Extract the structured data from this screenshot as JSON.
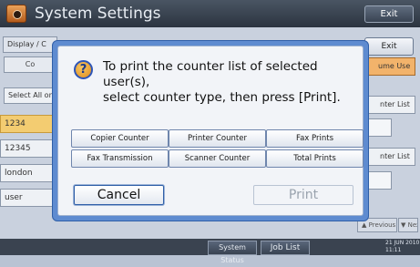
{
  "titlebar": {
    "title": "System Settings",
    "exit_label": "Exit"
  },
  "background": {
    "tab_display": "Display / C",
    "exit_label": "Exit",
    "tab_second": "Co",
    "tab_volume": "ume Use",
    "select_all": "Select All on",
    "printer_list_1": "nter List",
    "printer_list_2": "nter List",
    "rows": [
      "1234",
      "12345",
      "london",
      "user"
    ],
    "previous_label": "Previous",
    "next_label": "Next"
  },
  "dialog": {
    "message_line1": "To print the counter list of selected user(s),",
    "message_line2": "select counter type, then press [Print].",
    "counter_buttons": [
      "Copier Counter",
      "Printer Counter",
      "Fax Prints",
      "Fax Transmission",
      "Scanner Counter",
      "Total Prints"
    ],
    "cancel_label": "Cancel",
    "print_label": "Print"
  },
  "bottombar": {
    "system_status_label": "System Status",
    "job_list_label": "Job List",
    "date": "21 JUN 2010",
    "time": "11:11"
  },
  "colors": {
    "dialog_border": "#5e8bd0",
    "selected_row": "#f3cc71",
    "active_tab": "#f2b36b"
  }
}
